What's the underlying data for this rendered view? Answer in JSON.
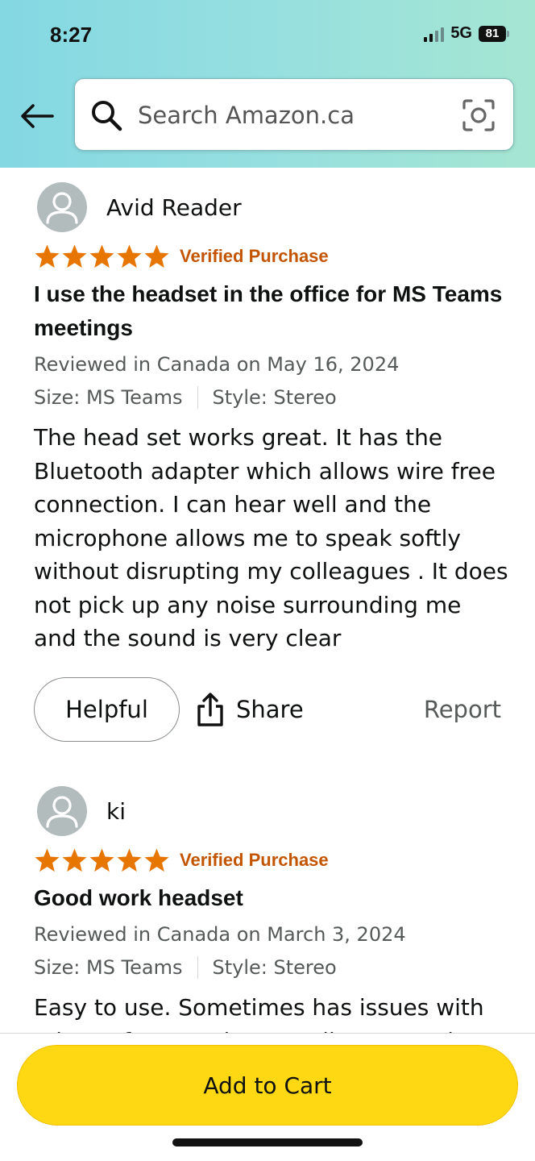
{
  "status_bar": {
    "time": "8:27",
    "network": "5G",
    "battery": "81"
  },
  "search": {
    "placeholder": "Search Amazon.ca"
  },
  "reviews": [
    {
      "reviewer": "Avid Reader",
      "rating": 5,
      "verified": "Verified Purchase",
      "title": "I use the headset in the office for MS Teams meetings",
      "date": "Reviewed in Canada on May 16, 2024",
      "size": "Size: MS Teams",
      "style": "Style: Stereo",
      "body": "The head set works great. It has the Bluetooth adapter which allows wire free connection. I can hear well and the microphone allows me to speak softly without disrupting my colleagues . It does not pick up any noise surrounding me and the sound is very clear"
    },
    {
      "reviewer": "ki",
      "rating": 5,
      "verified": "Verified Purchase",
      "title": "Good work headset",
      "date": "Reviewed in Canada on March 3, 2024",
      "size": "Size: MS Teams",
      "style": "Style: Stereo",
      "body": "Easy to use. Sometimes has issues with microsoft teams but usually can get it"
    }
  ],
  "actions": {
    "helpful": "Helpful",
    "share": "Share",
    "report": "Report"
  },
  "cart": {
    "label": "Add to Cart"
  },
  "colors": {
    "star": "#e77600",
    "verified": "#c45500",
    "cart_button": "#ffd814"
  }
}
